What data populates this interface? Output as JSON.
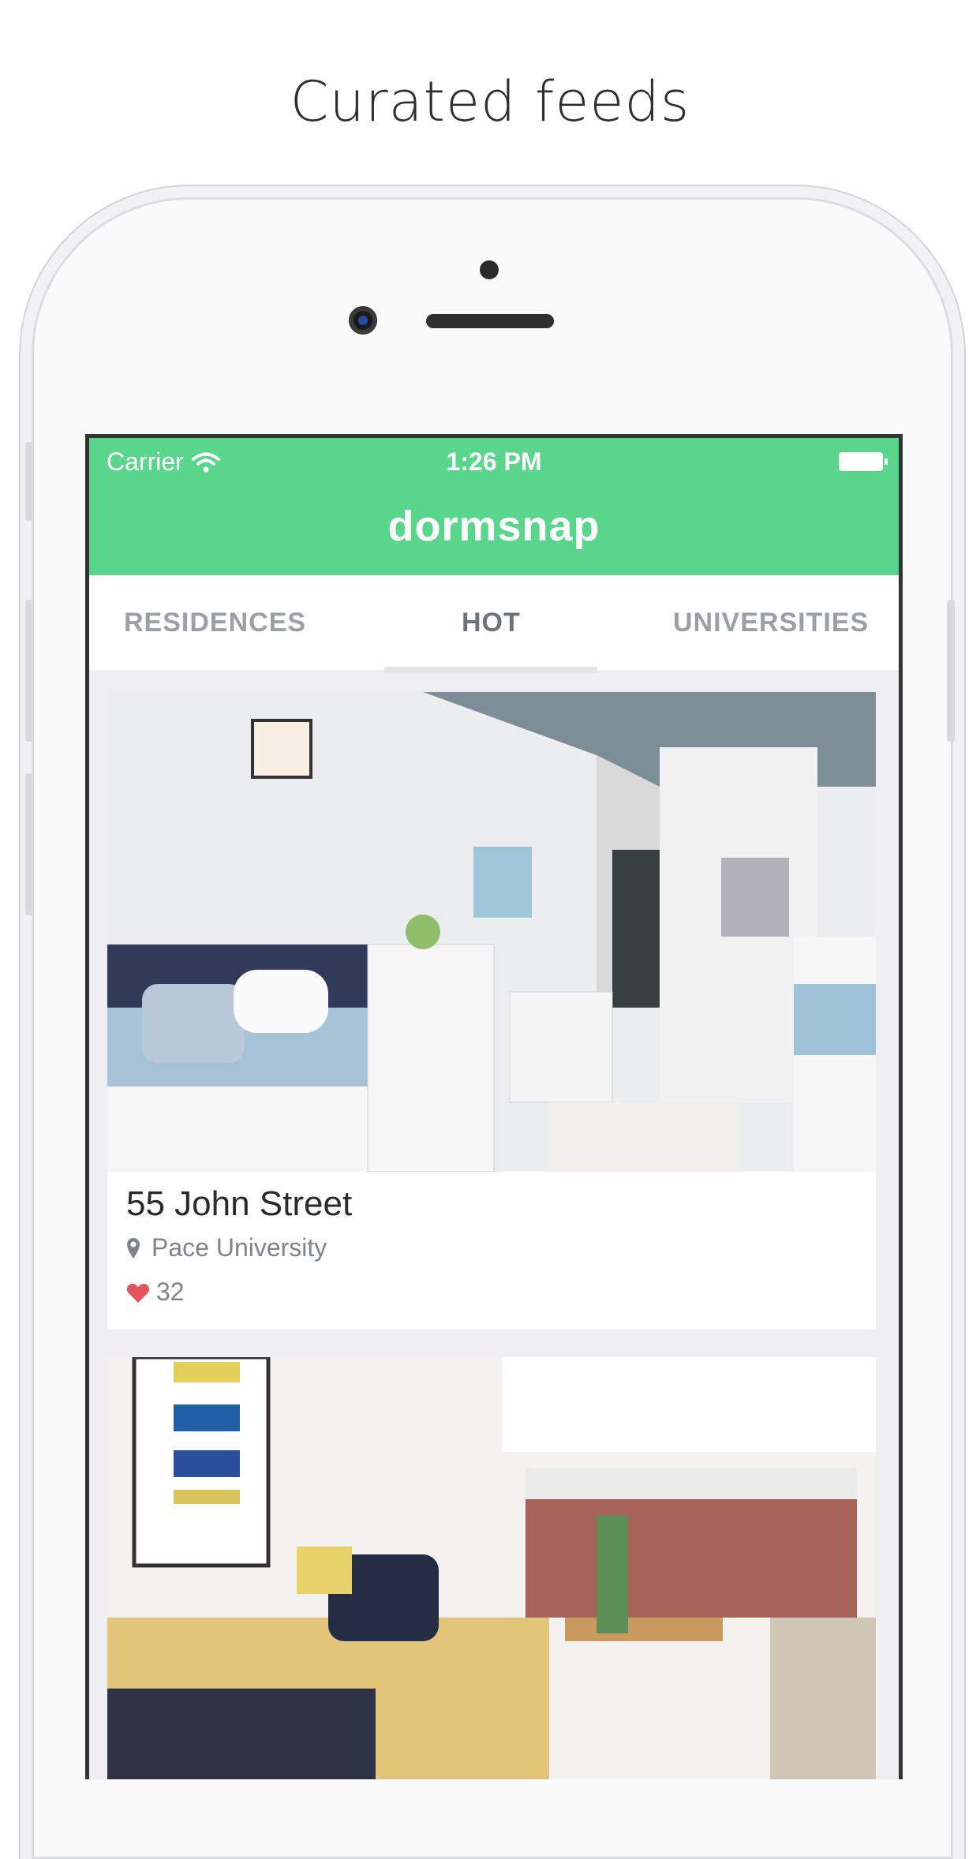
{
  "headline": "Curated feeds",
  "status": {
    "carrier": "Carrier",
    "time": "1:26 PM"
  },
  "nav": {
    "title": "dormsnap"
  },
  "tabs": [
    {
      "label": "RESIDENCES"
    },
    {
      "label": "HOT"
    },
    {
      "label": "UNIVERSITIES"
    }
  ],
  "feed": [
    {
      "title": "55 John Street",
      "university": "Pace University",
      "likes": "32"
    }
  ],
  "colors": {
    "accent": "#5ad58c",
    "like": "#e4545f"
  }
}
